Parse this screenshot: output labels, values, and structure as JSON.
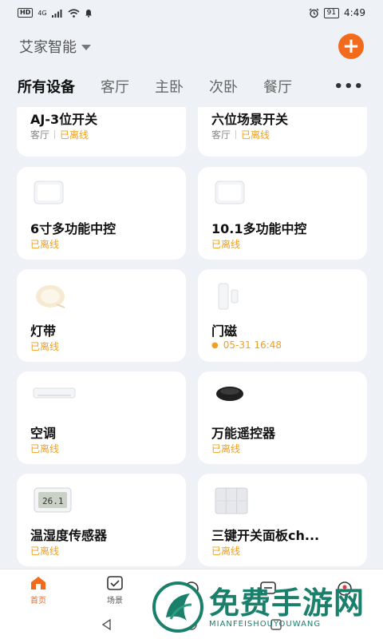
{
  "status_bar": {
    "hd": "HD",
    "network": "4G",
    "battery": "91",
    "time": "4:49"
  },
  "header": {
    "home_name": "艾家智能"
  },
  "tabs": [
    "所有设备",
    "客厅",
    "主卧",
    "次卧",
    "餐厅"
  ],
  "devices": [
    {
      "name": "AJ-3位开关",
      "room": "客厅",
      "status": "已离线"
    },
    {
      "name": "六位场景开关",
      "room": "客厅",
      "status": "已离线"
    },
    {
      "name": "6寸多功能中控",
      "room": "",
      "status": "已离线"
    },
    {
      "name": "10.1多功能中控",
      "room": "",
      "status": "已离线"
    },
    {
      "name": "灯带",
      "room": "",
      "status": "已离线"
    },
    {
      "name": "门磁",
      "room": "",
      "status": "05-31 16:48"
    },
    {
      "name": "空调",
      "room": "",
      "status": "已离线"
    },
    {
      "name": "万能遥控器",
      "room": "",
      "status": "已离线"
    },
    {
      "name": "温湿度传感器",
      "room": "",
      "status": "已离线"
    },
    {
      "name": "三键开关面板ch...",
      "room": "",
      "status": "已离线"
    }
  ],
  "bottom_nav": [
    {
      "label": "首页",
      "icon": "home-icon"
    },
    {
      "label": "场景",
      "icon": "scene-icon"
    },
    {
      "label": "",
      "icon": "smart-icon"
    },
    {
      "label": "",
      "icon": "message-icon"
    },
    {
      "label": "",
      "icon": "profile-icon"
    }
  ],
  "watermark": {
    "title": "免费手游网",
    "subtitle": "MIANFEISHOUYOUWANG"
  },
  "colors": {
    "accent": "#f26b1d",
    "offline": "#f0a020",
    "background": "#eef2f7"
  }
}
